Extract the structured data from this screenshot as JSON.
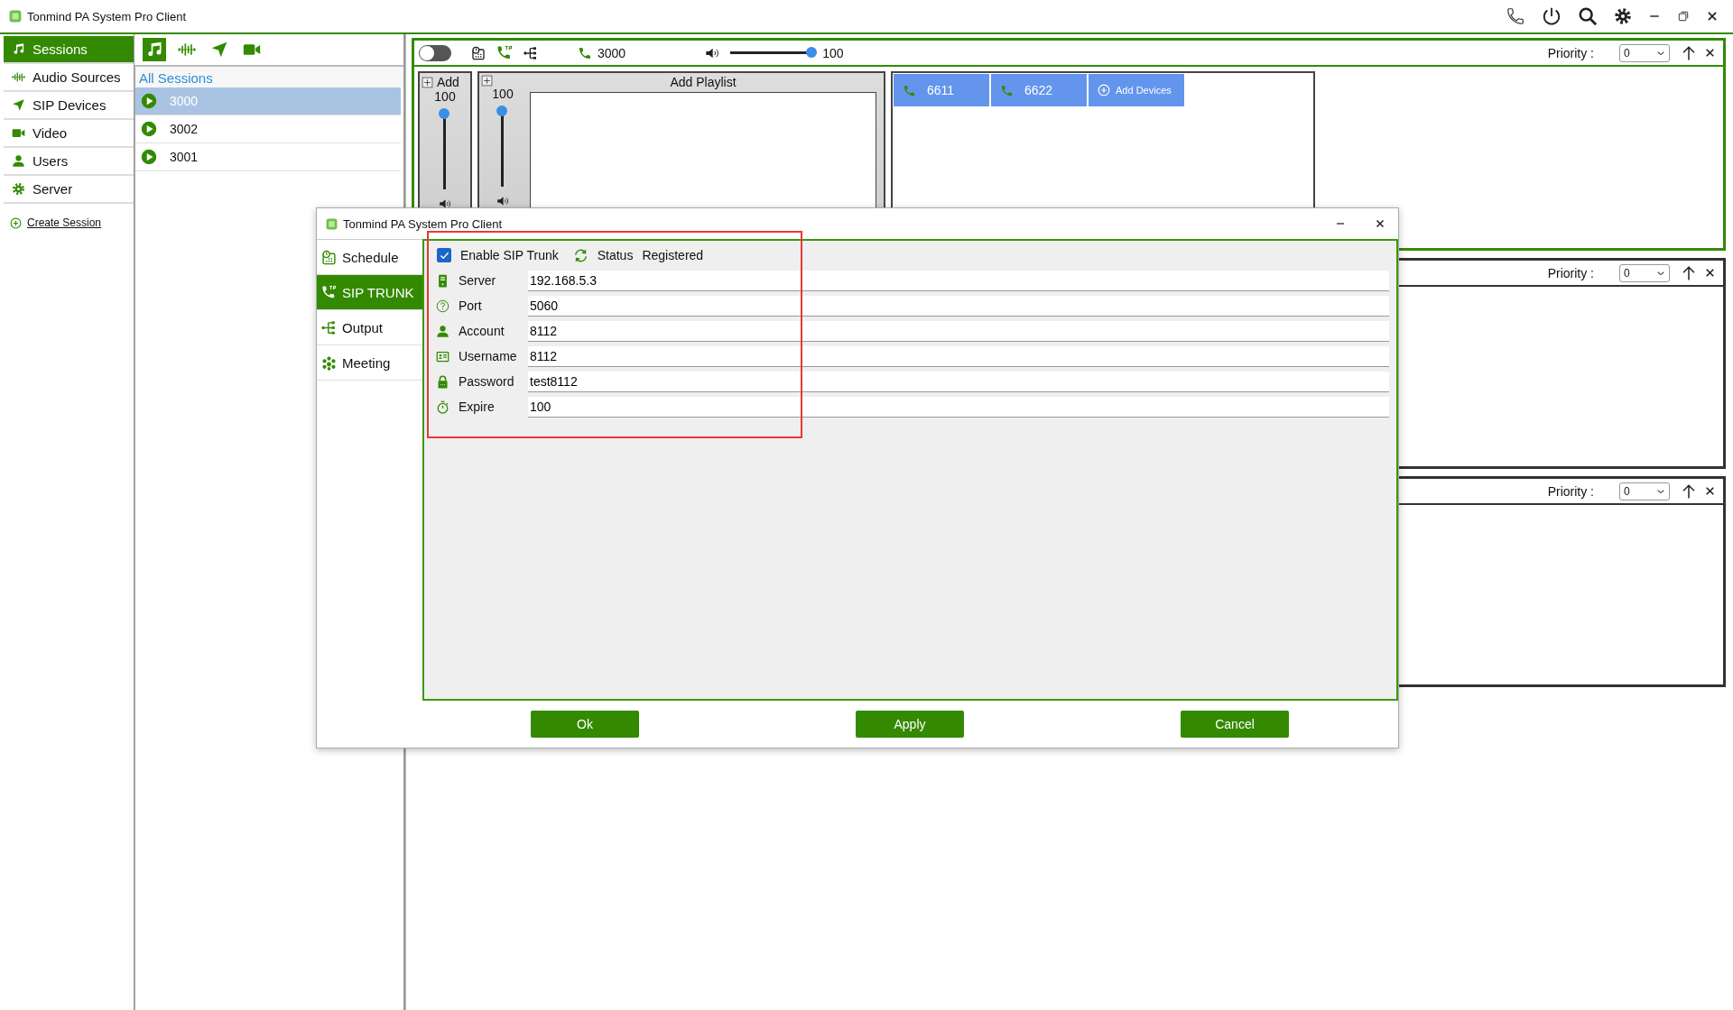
{
  "window": {
    "title": "Tonmind PA System Pro Client"
  },
  "nav": {
    "items": [
      {
        "kind": "music",
        "label": "Sessions",
        "selected": true
      },
      {
        "kind": "wave",
        "label": "Audio Sources",
        "selected": false
      },
      {
        "kind": "arrow",
        "label": "SIP Devices",
        "selected": false
      },
      {
        "kind": "video",
        "label": "Video",
        "selected": false
      },
      {
        "kind": "user",
        "label": "Users",
        "selected": false
      },
      {
        "kind": "gear",
        "label": "Server",
        "selected": false
      }
    ],
    "create_link": "Create Session"
  },
  "list_toolbar": [
    {
      "kind": "music",
      "selected": true
    },
    {
      "kind": "wave",
      "selected": false
    },
    {
      "kind": "arrow",
      "selected": false
    },
    {
      "kind": "video",
      "selected": false
    }
  ],
  "sessions": {
    "header": "All Sessions",
    "items": [
      {
        "label": "3000",
        "selected": true
      },
      {
        "label": "3002",
        "selected": false
      },
      {
        "label": "3001",
        "selected": false
      }
    ]
  },
  "session_panels": [
    {
      "selected": true,
      "enabled": false,
      "number": "3000",
      "volume": {
        "level": 1,
        "reading": "100"
      },
      "priority_label": "Priority :",
      "priority": "0",
      "channels": [
        {
          "kind": "input",
          "label": "Add",
          "level": 1,
          "reading": "100"
        },
        {
          "kind": "playlist",
          "label": "Add Playlist",
          "level": 1,
          "reading": "100"
        }
      ],
      "devices": [
        {
          "kind": "phone",
          "label": "6611"
        },
        {
          "kind": "phone",
          "label": "6622"
        },
        {
          "kind": "add",
          "label": "Add Devices"
        }
      ]
    },
    {
      "selected": false,
      "priority_label": "Priority :",
      "priority": "0"
    },
    {
      "selected": false,
      "priority_label": "Priority :",
      "priority": "0"
    }
  ],
  "dialog": {
    "title": "Tonmind PA System Pro Client",
    "tabs": [
      {
        "kind": "schedule",
        "label": "Schedule",
        "selected": false
      },
      {
        "kind": "sip",
        "label": "SIP TRUNK",
        "selected": true
      },
      {
        "kind": "output",
        "label": "Output",
        "selected": false
      },
      {
        "kind": "meeting",
        "label": "Meeting",
        "selected": false
      }
    ],
    "enable": {
      "label": "Enable SIP Trunk",
      "checked": true
    },
    "status": {
      "label": "Status",
      "value": "Registered"
    },
    "fields": [
      {
        "kind": "server",
        "label": "Server",
        "value": "192.168.5.3"
      },
      {
        "kind": "help",
        "label": "Port",
        "value": "5060"
      },
      {
        "kind": "user",
        "label": "Account",
        "value": "8112"
      },
      {
        "kind": "card",
        "label": "Username",
        "value": "8112"
      },
      {
        "kind": "lock",
        "label": "Password",
        "value": "test8112"
      },
      {
        "kind": "timer",
        "label": "Expire",
        "value": "100"
      }
    ],
    "buttons": [
      {
        "label": "Ok"
      },
      {
        "label": "Apply"
      },
      {
        "label": "Cancel"
      }
    ],
    "annotation": {
      "kind": "frame"
    }
  }
}
